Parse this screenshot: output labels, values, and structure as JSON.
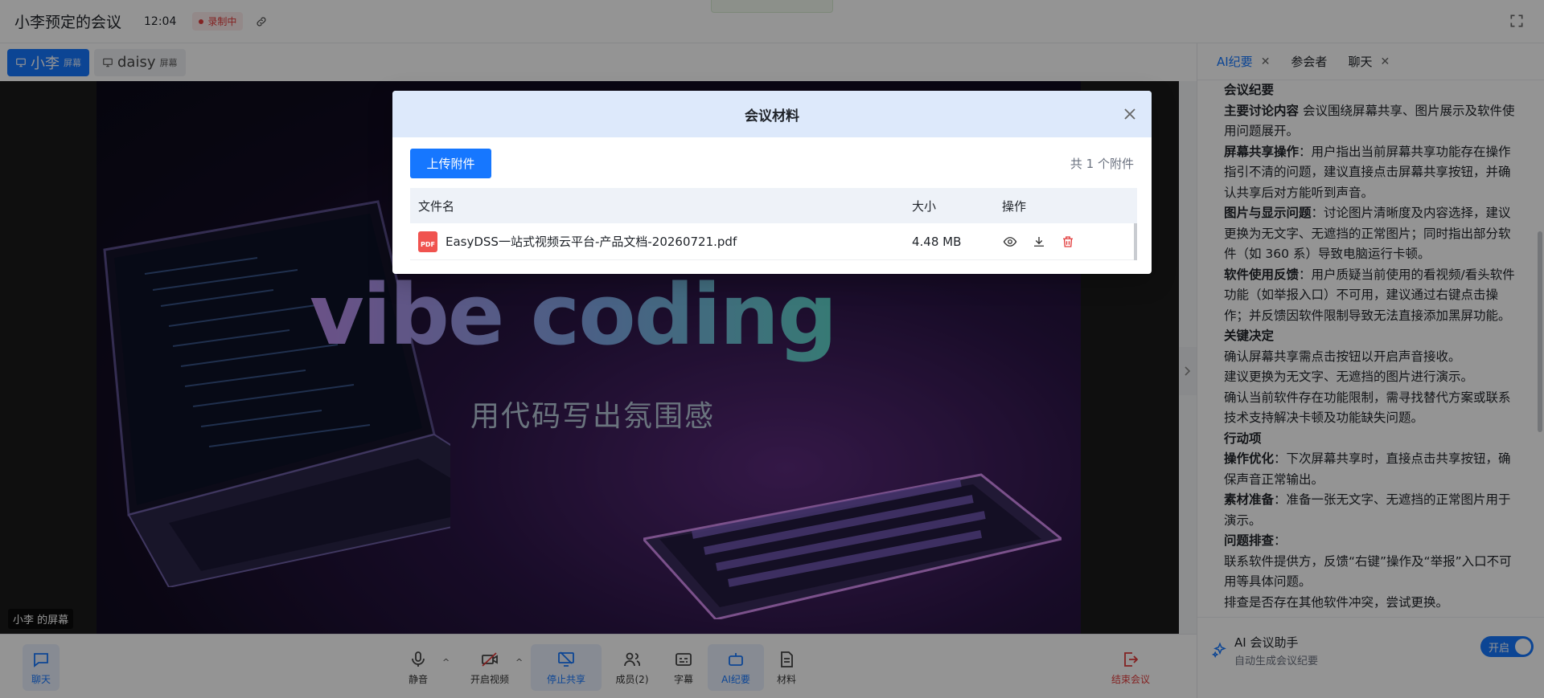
{
  "header": {
    "title": "小李预定的会议",
    "time": "12:04",
    "recording_label": "录制中"
  },
  "share_bar": {
    "items": [
      {
        "name": "小李",
        "tag": "屏幕"
      },
      {
        "name": "daisy",
        "tag": "屏幕"
      }
    ]
  },
  "video": {
    "headline": "vibe coding",
    "subtitle": "用代码写出氛围感",
    "screen_label": "小李 的屏幕"
  },
  "right_panel": {
    "tabs": [
      {
        "label": "AI纪要"
      },
      {
        "label": "参会者"
      },
      {
        "label": "聊天"
      }
    ],
    "minutes": [
      {
        "bold": "会议纪要",
        "text": ""
      },
      {
        "bold": "主要讨论内容",
        "text": " 会议围绕屏幕共享、图片展示及软件使用问题展开。"
      },
      {
        "bold": "屏幕共享操作",
        "text": "：用户指出当前屏幕共享功能存在操作指引不清的问题，建议直接点击屏幕共享按钮，并确认共享后对方能听到声音。"
      },
      {
        "bold": "图片与显示问题",
        "text": "：讨论图片清晰度及内容选择，建议更换为无文字、无遮挡的正常图片；同时指出部分软件（如 360 系）导致电脑运行卡顿。"
      },
      {
        "bold": "软件使用反馈",
        "text": "：用户质疑当前使用的看视频/看头软件功能（如举报入口）不可用，建议通过右键点击操作；并反馈因软件限制导致无法直接添加黑屏功能。"
      },
      {
        "bold": "关键决定",
        "text": ""
      },
      {
        "bold": "",
        "text": "确认屏幕共享需点击按钮以开启声音接收。"
      },
      {
        "bold": "",
        "text": "建议更换为无文字、无遮挡的图片进行演示。"
      },
      {
        "bold": "",
        "text": "确认当前软件存在功能限制，需寻找替代方案或联系技术支持解决卡顿及功能缺失问题。"
      },
      {
        "bold": "行动项",
        "text": ""
      },
      {
        "bold": "操作优化",
        "text": "：下次屏幕共享时，直接点击共享按钮，确保声音正常输出。"
      },
      {
        "bold": "素材准备",
        "text": "：准备一张无文字、无遮挡的正常图片用于演示。"
      },
      {
        "bold": "问题排查",
        "text": "："
      },
      {
        "bold": "",
        "text": "联系软件提供方，反馈“右键”操作及“举报”入口不可用等具体问题。"
      },
      {
        "bold": "",
        "text": "排查是否存在其他软件冲突，尝试更换。"
      }
    ],
    "assistant": {
      "title": "AI 会议助手",
      "subtitle": "自动生成会议纪要",
      "toggle_label": "开启"
    }
  },
  "bottom_bar": {
    "chat": "聊天",
    "mute": "静音",
    "video": "开启视频",
    "stop_share": "停止共享",
    "members": "成员(2)",
    "subtitles": "字幕",
    "ai_minutes": "AI纪要",
    "materials": "材料",
    "end": "结束会议"
  },
  "modal": {
    "title": "会议材料",
    "upload_label": "上传附件",
    "count_text": "共 1 个附件",
    "columns": [
      "文件名",
      "大小",
      "操作"
    ],
    "files": [
      {
        "icon_text": "PDF",
        "name": "EasyDSS一站式视频云平台-产品文档-20260721.pdf",
        "size": "4.48 MB"
      }
    ]
  },
  "colors": {
    "accent": "#1677ff",
    "danger": "#e23c3c",
    "modal_header": "#dde9fb",
    "pdf": "#f0534f"
  },
  "icons": [
    "link-icon",
    "fullscreen-icon",
    "monitor-icon",
    "chat-icon",
    "mic-icon",
    "video-off-icon",
    "share-off-icon",
    "members-icon",
    "subtitles-icon",
    "robot-icon",
    "document-icon",
    "exit-icon",
    "sparkle-icon",
    "close-icon",
    "eye-icon",
    "download-icon",
    "trash-icon",
    "chevron-right-icon"
  ]
}
